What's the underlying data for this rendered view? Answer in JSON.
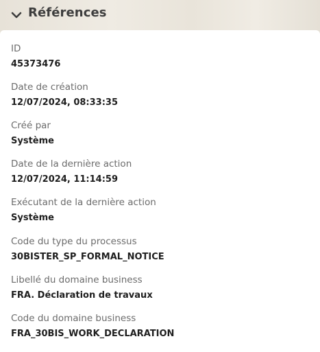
{
  "section": {
    "title": "Références",
    "toggle_icon": "chevron-down-icon"
  },
  "fields": [
    {
      "label": "ID",
      "value": "45373476"
    },
    {
      "label": "Date de création",
      "value": "12/07/2024, 08:33:35"
    },
    {
      "label": "Créé par",
      "value": "Système"
    },
    {
      "label": "Date de la dernière action",
      "value": "12/07/2024, 11:14:59"
    },
    {
      "label": "Exécutant de la dernière action",
      "value": "Système"
    },
    {
      "label": "Code du type du processus",
      "value": "30BISTER_SP_FORMAL_NOTICE"
    },
    {
      "label": "Libellé du domaine business",
      "value": "FRA. Déclaration de travaux"
    },
    {
      "label": "Code du domaine business",
      "value": "FRA_30BIS_WORK_DECLARATION"
    }
  ]
}
